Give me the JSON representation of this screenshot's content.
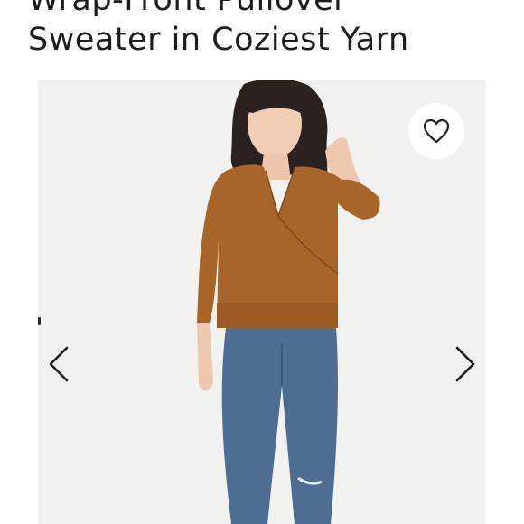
{
  "product": {
    "title_lines": [
      "Wrap-Front Pullover",
      "Sweater in Coziest Yarn"
    ]
  },
  "gallery": {
    "image_desc": "model-wearing-rust-wrap-sweater-and-jeans",
    "favorite_icon": "heart-outline-icon",
    "prev_icon": "chevron-left-icon",
    "next_icon": "chevron-right-icon"
  },
  "colors": {
    "sweater": "#a8652a",
    "denim": "#4d6d93",
    "background": "#f1f1ef",
    "text": "#1c1c1c"
  }
}
